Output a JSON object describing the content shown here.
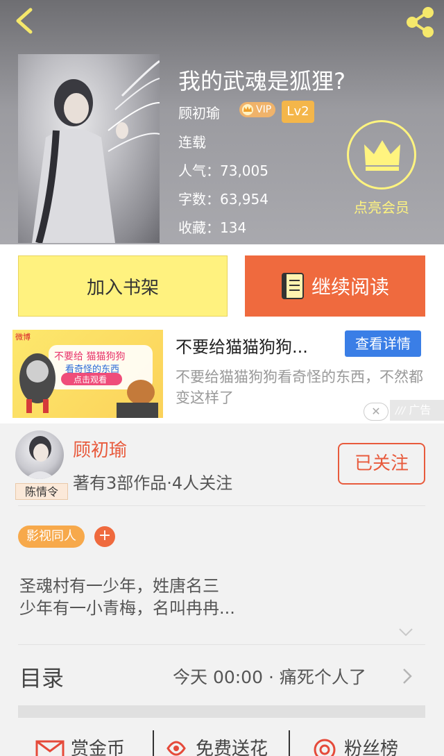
{
  "header": {
    "book_title": "我的武魂是狐狸?",
    "author": "顾初瑜",
    "vip_label": "VIP",
    "level": "Lv2",
    "status": "连载",
    "popularity": "人气：73,005",
    "word_count": "字数：63,954",
    "favorites": "收藏：134",
    "member_label": "点亮会员",
    "colors": {
      "accent_yellow": "#fff47f",
      "badge_orange": "#f4b64a"
    }
  },
  "actions": {
    "add_to_shelf": "加入书架",
    "continue_reading": "继续阅读",
    "colors": {
      "shelf_bg": "#fff27f",
      "read_bg": "#ef6a3e"
    }
  },
  "ad": {
    "title": "不要给猫猫狗狗...",
    "detail_button": "查看详情",
    "description": "不要给猫猫狗狗看奇怪的东西，不然都变这样了",
    "tag": "广告",
    "close_icon": "close-icon",
    "image_source": "微博",
    "image_text_line1": "不要给 猫猫狗狗",
    "image_text_line2": "看奇怪的东西",
    "image_button": "点击观看"
  },
  "author_card": {
    "name": "顾初瑜",
    "avatar_tag": "陈情令",
    "works_info": "著有3部作品·4人关注",
    "follow_button": "已关注",
    "genre_tag": "影视同人",
    "add_tag": "+",
    "synopsis": "圣魂村有一少年，姓唐名三\n少年有一小青梅，名叫冉冉...",
    "colors": {
      "name": "#e85a3c"
    }
  },
  "toc": {
    "title": "目录",
    "latest": "今天 00:00 · 痛死个人了"
  },
  "bottom_bar": {
    "items": [
      "赏金币",
      "免费送花",
      "粉丝榜"
    ]
  }
}
